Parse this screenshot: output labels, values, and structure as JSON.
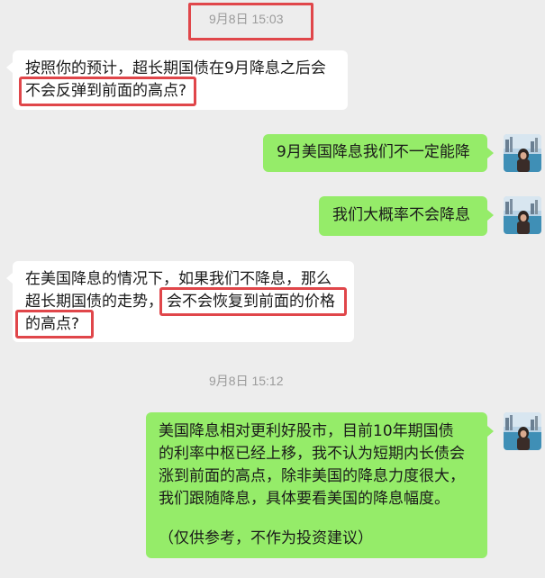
{
  "timestamps": {
    "first": "9月8日 15:03",
    "second": "9月8日 15:12"
  },
  "messages": {
    "m1": {
      "line1": "按照你的预计，超长期国债在9月降息之后会",
      "line2": "不会反弹到前面的高点?"
    },
    "m2": {
      "text": "9月美国降息我们不一定能降"
    },
    "m3": {
      "text": "我们大概率不会降息"
    },
    "m4": {
      "line1": "在美国降息的情况下，如果我们不降息，那么",
      "line2a": "超长期国债的走势，",
      "line2b": "会不会恢复到前面的价格",
      "line3": "的高点?"
    },
    "m5": {
      "line1": "美国降息相对更利好股市，目前10年期国债",
      "line2": "的利率中枢已经上移，我不认为短期内长债会",
      "line3": "涨到前面的高点，除非美国的降息力度很大，",
      "line4": "我们跟随降息，具体要看美国的降息幅度。",
      "line5": "（仅供参考，不作为投资建议）"
    }
  },
  "colors": {
    "background": "#ededed",
    "incoming_bubble": "#ffffff",
    "outgoing_bubble": "#95ec69",
    "highlight": "#e0464a"
  },
  "icons": {
    "avatar": "user-avatar-photo-icon"
  }
}
